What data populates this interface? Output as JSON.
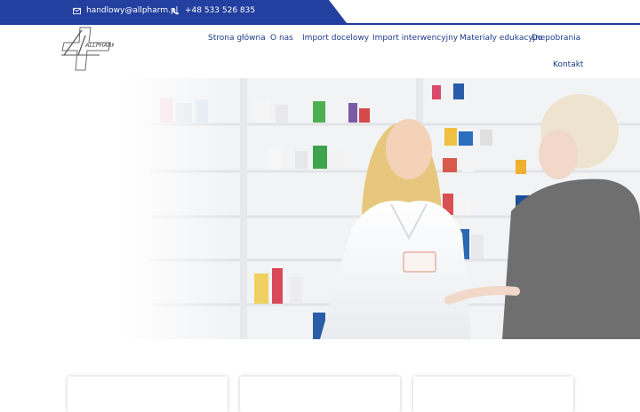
{
  "topbar": {
    "email": "handlowy@allpharm.pl",
    "phone": "+48 533 526 835",
    "colors": {
      "accent": "#233f9f",
      "text": "#ffffff"
    }
  },
  "brand": {
    "logo_text": "ALLPHARM"
  },
  "nav": {
    "items": [
      {
        "label": "Strona główna"
      },
      {
        "label": "O nas"
      },
      {
        "label": "Import docelowy"
      },
      {
        "label": "Import interwencyjny"
      },
      {
        "label": "Materiały edukacyjne"
      },
      {
        "label": "Do pobrania"
      },
      {
        "label": "Kontakt"
      }
    ],
    "color": "#1d3a8a"
  },
  "icons": {
    "email": "envelope-icon",
    "phone": "phone-icon"
  }
}
